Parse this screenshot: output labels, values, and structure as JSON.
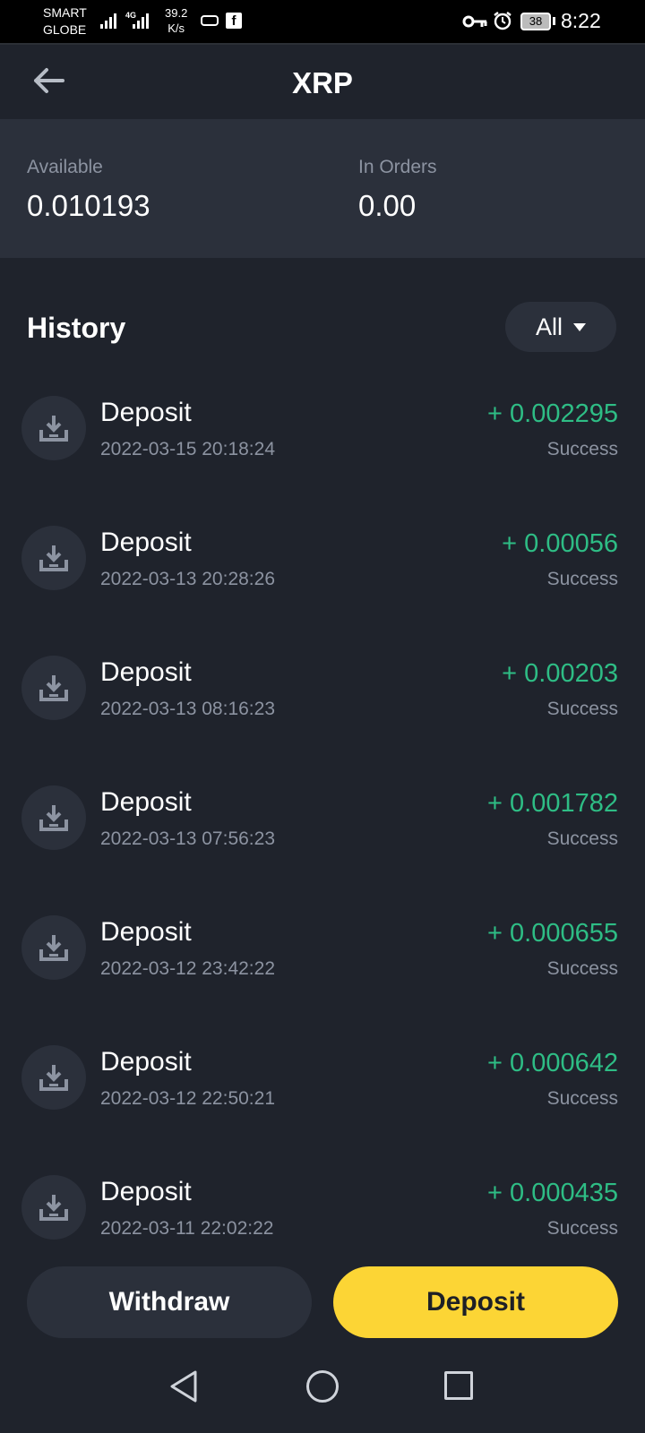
{
  "status_bar": {
    "carrier_line1": "SMART",
    "carrier_line2": "GLOBE",
    "network_tag": "4G",
    "speed_value": "39.2",
    "speed_unit": "K/s",
    "battery": "38",
    "time": "8:22"
  },
  "header": {
    "title": "XRP"
  },
  "balance": {
    "available_label": "Available",
    "available_value": "0.010193",
    "in_orders_label": "In Orders",
    "in_orders_value": "0.00"
  },
  "history": {
    "title": "History",
    "filter_label": "All",
    "items": [
      {
        "type": "Deposit",
        "date": "2022-03-15 20:18:24",
        "amount": "+ 0.002295",
        "status": "Success"
      },
      {
        "type": "Deposit",
        "date": "2022-03-13 20:28:26",
        "amount": "+ 0.00056",
        "status": "Success"
      },
      {
        "type": "Deposit",
        "date": "2022-03-13 08:16:23",
        "amount": "+ 0.00203",
        "status": "Success"
      },
      {
        "type": "Deposit",
        "date": "2022-03-13 07:56:23",
        "amount": "+ 0.001782",
        "status": "Success"
      },
      {
        "type": "Deposit",
        "date": "2022-03-12 23:42:22",
        "amount": "+ 0.000655",
        "status": "Success"
      },
      {
        "type": "Deposit",
        "date": "2022-03-12 22:50:21",
        "amount": "+ 0.000642",
        "status": "Success"
      },
      {
        "type": "Deposit",
        "date": "2022-03-11 22:02:22",
        "amount": "+ 0.000435",
        "status": "Success"
      }
    ]
  },
  "actions": {
    "withdraw_label": "Withdraw",
    "deposit_label": "Deposit"
  },
  "colors": {
    "background": "#1f232c",
    "card": "#2b303b",
    "positive": "#2ebd85",
    "accent": "#fcd535",
    "muted_text": "#8c93a1"
  },
  "icons": {
    "row_icon": "download-icon",
    "back": "arrow-left-icon"
  }
}
